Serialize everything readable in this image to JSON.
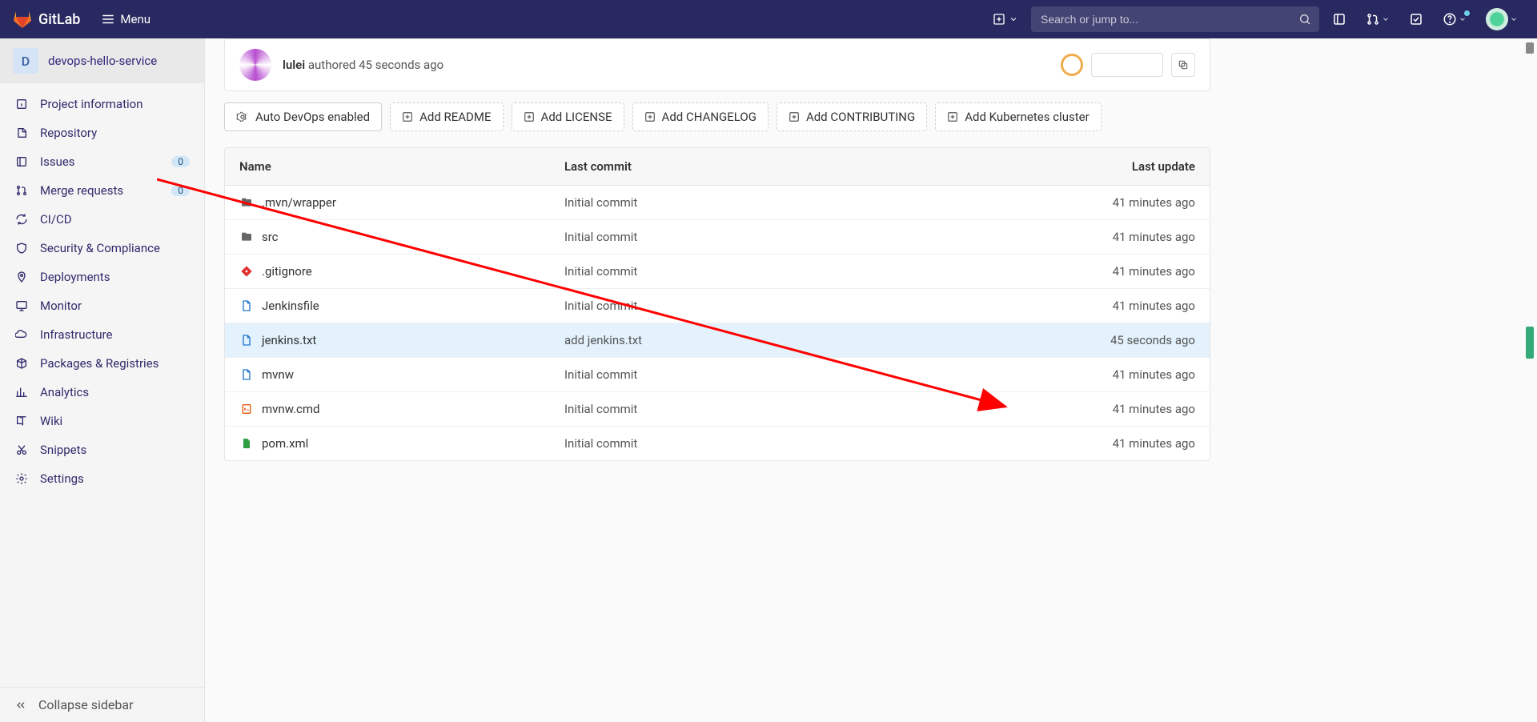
{
  "navbar": {
    "brand": "GitLab",
    "menu_label": "Menu",
    "search_placeholder": "Search or jump to..."
  },
  "sidebar": {
    "project_letter": "D",
    "project_name": "devops-hello-service",
    "items": [
      {
        "icon": "info",
        "label": "Project information"
      },
      {
        "icon": "repo",
        "label": "Repository"
      },
      {
        "icon": "issues",
        "label": "Issues",
        "badge": "0"
      },
      {
        "icon": "merge",
        "label": "Merge requests",
        "badge": "0"
      },
      {
        "icon": "cicd",
        "label": "CI/CD"
      },
      {
        "icon": "shield",
        "label": "Security & Compliance"
      },
      {
        "icon": "deploy",
        "label": "Deployments"
      },
      {
        "icon": "monitor",
        "label": "Monitor"
      },
      {
        "icon": "infra",
        "label": "Infrastructure"
      },
      {
        "icon": "package",
        "label": "Packages & Registries"
      },
      {
        "icon": "analytics",
        "label": "Analytics"
      },
      {
        "icon": "wiki",
        "label": "Wiki"
      },
      {
        "icon": "snippets",
        "label": "Snippets"
      },
      {
        "icon": "settings",
        "label": "Settings"
      }
    ],
    "collapse_label": "Collapse sidebar"
  },
  "latest_commit": {
    "author": "lulei",
    "verb": "authored",
    "when": "45 seconds ago"
  },
  "actions": {
    "autodevops": "Auto DevOps enabled",
    "add_readme": "Add README",
    "add_license": "Add LICENSE",
    "add_changelog": "Add CHANGELOG",
    "add_contributing": "Add CONTRIBUTING",
    "add_k8s": "Add Kubernetes cluster"
  },
  "table": {
    "headers": {
      "name": "Name",
      "commit": "Last commit",
      "update": "Last update"
    },
    "rows": [
      {
        "icon": "folder",
        "name": ".mvn/wrapper",
        "commit": "Initial commit",
        "update": "41 minutes ago",
        "highlight": false
      },
      {
        "icon": "folder",
        "name": "src",
        "commit": "Initial commit",
        "update": "41 minutes ago",
        "highlight": false
      },
      {
        "icon": "gitignore",
        "name": ".gitignore",
        "commit": "Initial commit",
        "update": "41 minutes ago",
        "highlight": false
      },
      {
        "icon": "file-blue",
        "name": "Jenkinsfile",
        "commit": "Initial commit",
        "update": "41 minutes ago",
        "highlight": false
      },
      {
        "icon": "file-blue",
        "name": "jenkins.txt",
        "commit": "add jenkins.txt",
        "update": "45 seconds ago",
        "highlight": true
      },
      {
        "icon": "file-blue",
        "name": "mvnw",
        "commit": "Initial commit",
        "update": "41 minutes ago",
        "highlight": false
      },
      {
        "icon": "file-orange",
        "name": "mvnw.cmd",
        "commit": "Initial commit",
        "update": "41 minutes ago",
        "highlight": false
      },
      {
        "icon": "file-green",
        "name": "pom.xml",
        "commit": "Initial commit",
        "update": "41 minutes ago",
        "highlight": false
      }
    ]
  }
}
